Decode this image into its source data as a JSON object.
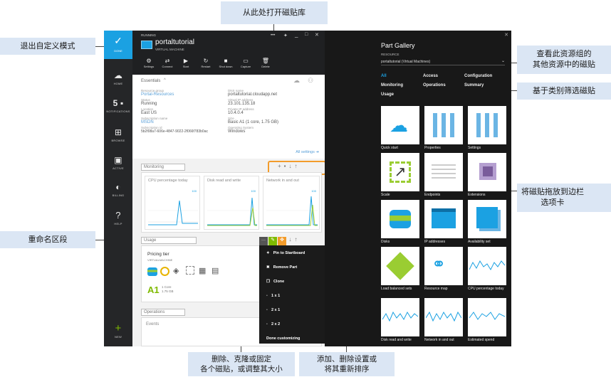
{
  "callouts": {
    "open_gallery": "从此处打开磁贴库",
    "exit_customize": "退出自定义模式",
    "view_other_tiles": "查看此资源组的\n其他资源中的磁贴",
    "filter_by_category": "基于类别筛选磁贴",
    "drag_tile": "将磁贴拖放到边栏\n选项卡",
    "rename_section": "重命名区段",
    "delete_clone_pin": "删除、克隆或固定\n各个磁贴，或调整其大小",
    "add_delete_reorder": "添加、删除设置或\n将其重新排序"
  },
  "nav": {
    "done_label": "DONE",
    "home_label": "HOME",
    "notif_count": "5",
    "notif_label": "NOTIFICATIONS",
    "browse_label": "BROWSE",
    "active_label": "ACTIVE",
    "billing_label": "BILLING",
    "help_label": "HELP",
    "new_label": "NEW"
  },
  "blade": {
    "status": "RUNNING",
    "title": "portaltutorial",
    "subtitle": "VIRTUAL MACHINE",
    "toolbar": [
      "Settings",
      "Connect",
      "Start",
      "Restart",
      "Shut down",
      "Capture",
      "Delete"
    ],
    "essentials_title": "Essentials",
    "essentials_left": [
      {
        "label": "Resource group",
        "value": "Portal-Resources",
        "link": true
      },
      {
        "label": "Status",
        "value": "Running",
        "link": false
      },
      {
        "label": "Location",
        "value": "East US",
        "link": false
      },
      {
        "label": "Subscription name",
        "value": "MSDN",
        "link": true
      },
      {
        "label": "Subscription id",
        "value": "5b2f08a7-606e-4847-9022-2f066f783b0ac",
        "link": false
      }
    ],
    "essentials_right": [
      {
        "label": "DNS name",
        "value": "portaltutorial.cloudapp.net"
      },
      {
        "label": "Virtual IP address",
        "value": "23.101.135.18"
      },
      {
        "label": "Private IP address",
        "value": "10.4.0.4"
      },
      {
        "label": "Size",
        "value": "Basic A1 (1 core, 1.75 GB)"
      },
      {
        "label": "Operating System",
        "value": "Windows"
      }
    ],
    "all_settings": "All settings ➔",
    "monitoring_section": "Monitoring",
    "monitoring_charts": [
      {
        "title": "CPU percentage today",
        "value": "100"
      },
      {
        "title": "Disk read and write",
        "value": "100"
      },
      {
        "title": "Network in and out",
        "value": "100"
      }
    ],
    "usage_section": "Usage",
    "pricing_tier": "Pricing tier",
    "pricing_sub": "VIRTUALMACHINE",
    "tier_name": "A1",
    "tier_cores": "1 Core",
    "tier_mem": "1.75 GB",
    "operations_section": "Operations",
    "events_label": "Events"
  },
  "context_menu": {
    "items": [
      "Pin to Startboard",
      "Remove Part",
      "Clone",
      "1 x 1",
      "2 x 1",
      "2 x 2",
      "Done customizing"
    ]
  },
  "gallery": {
    "title": "Part Gallery",
    "resource_label": "RESOURCE",
    "resource_value": "portaltutorial (Virtual Machines)",
    "categories": [
      "All",
      "Access",
      "Configuration",
      "Monitoring",
      "Operations",
      "Summary",
      "Usage"
    ],
    "tiles": [
      "Quick start",
      "Properties",
      "Settings",
      "Scale",
      "Endpoints",
      "Extensions",
      "Disks",
      "IP addresses",
      "Availability set",
      "Load balanced sets",
      "Resource map",
      "CPU percentage today",
      "Disk read and write",
      "Network in and out",
      "Estimated spend"
    ]
  },
  "colors": {
    "accent": "#1ba1e2",
    "highlight_orange": "#f39c2b",
    "gallery_bg": "#181818",
    "nav_bg": "#252628",
    "callout_bg": "#dbe6f4",
    "chart_line": "#1ba1e2",
    "chart_green": "#9acd32"
  }
}
